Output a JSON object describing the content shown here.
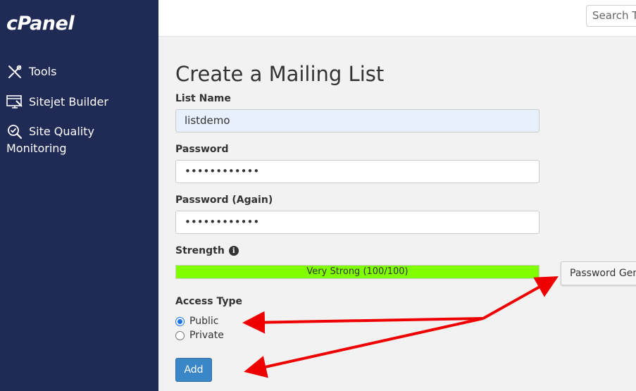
{
  "sidebar": {
    "logo": "cPanel",
    "items": [
      {
        "label": "Tools",
        "icon": "tools-icon"
      },
      {
        "label": "Sitejet Builder",
        "icon": "sitejet-icon"
      },
      {
        "label_line1": "Site Quality",
        "label_line2": "Monitoring",
        "icon": "site-quality-icon"
      }
    ]
  },
  "topbar": {
    "search_text": "Search T"
  },
  "form": {
    "title": "Create a Mailing List",
    "list_name_label": "List Name",
    "list_name_value": "listdemo",
    "password_label": "Password",
    "password_value": "••••••••••••",
    "password_again_label": "Password (Again)",
    "password_again_value": "••••••••••••",
    "strength_label": "Strength",
    "strength_text": "Very Strong (100/100)",
    "strength_fraction": 1.0,
    "password_generator_label": "Password Gene",
    "access_type_label": "Access Type",
    "access_options": [
      {
        "label": "Public",
        "checked": true
      },
      {
        "label": "Private",
        "checked": false
      }
    ],
    "add_button": "Add"
  },
  "colors": {
    "sidebar_bg": "#1f2a55",
    "meter_fill": "#80ff00",
    "add_button": "#3a87c8",
    "annotation_arrow": "#ee0000"
  }
}
